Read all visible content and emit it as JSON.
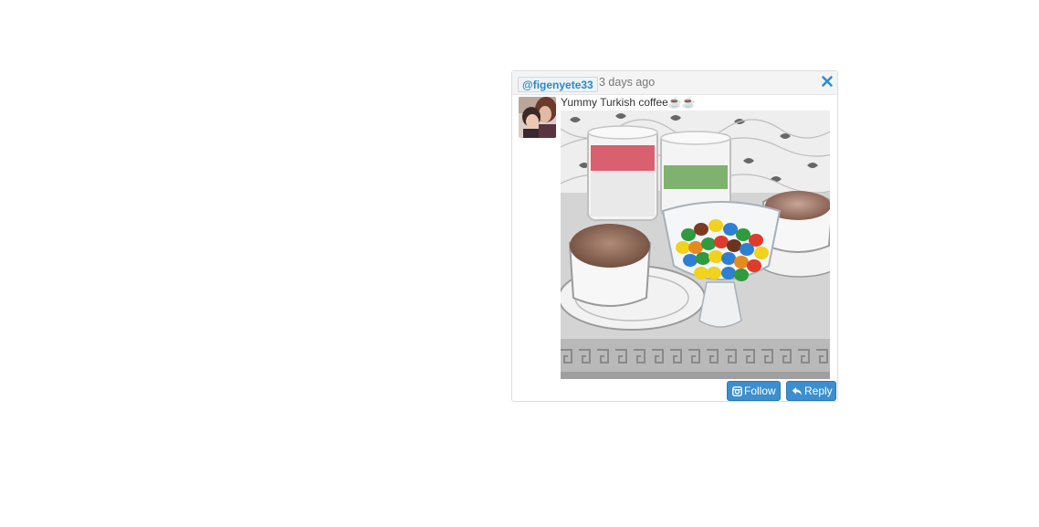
{
  "post": {
    "username": "@figenyete33",
    "timestamp": "3 days ago",
    "caption": "Yummy Turkish coffee☕☕",
    "follow_label": "Follow",
    "reply_label": "Reply"
  },
  "icons": {
    "close": "close-icon",
    "follow": "instagram-icon",
    "reply": "reply-icon"
  },
  "colors": {
    "accent": "#3b8fcf",
    "username": "#2a88c8",
    "header_bg": "#f4f4f4"
  }
}
